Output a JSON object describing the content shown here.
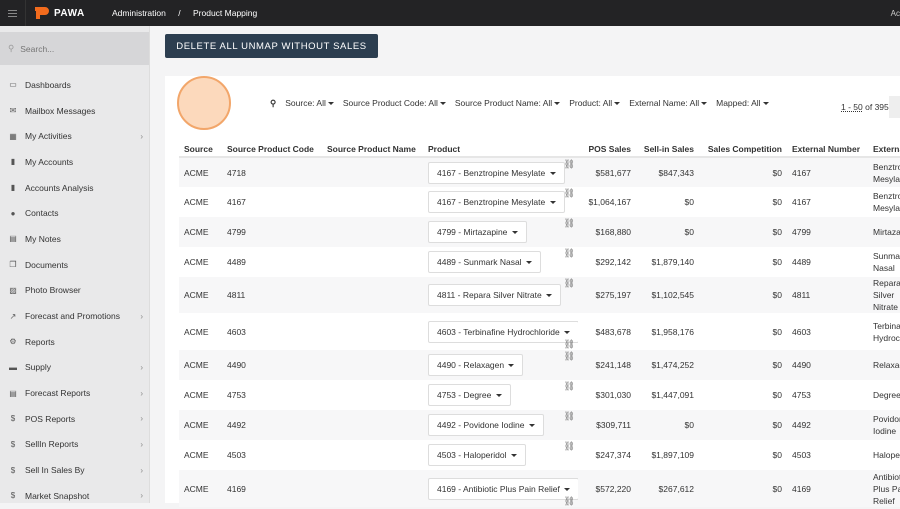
{
  "topbar": {
    "brand": "PAWA",
    "breadcrumb": [
      "Administration",
      "/",
      "Product Mapping"
    ],
    "user": "Ac"
  },
  "sidebar": {
    "search_placeholder": "Search...",
    "items": [
      {
        "label": "Dashboards",
        "icon": "monitor-icon",
        "chevron": false
      },
      {
        "label": "Mailbox Messages",
        "icon": "envelope-icon",
        "chevron": false
      },
      {
        "label": "My Activities",
        "icon": "calendar-icon",
        "chevron": true
      },
      {
        "label": "My Accounts",
        "icon": "building-icon",
        "chevron": false
      },
      {
        "label": "Accounts Analysis",
        "icon": "building-icon",
        "chevron": false
      },
      {
        "label": "Contacts",
        "icon": "user-icon",
        "chevron": false
      },
      {
        "label": "My Notes",
        "icon": "note-icon",
        "chevron": false
      },
      {
        "label": "Documents",
        "icon": "documents-icon",
        "chevron": false
      },
      {
        "label": "Photo Browser",
        "icon": "image-icon",
        "chevron": false
      },
      {
        "label": "Forecast and Promotions",
        "icon": "chart-line-icon",
        "chevron": true
      },
      {
        "label": "Reports",
        "icon": "gear-icon",
        "chevron": false
      },
      {
        "label": "Supply",
        "icon": "truck-icon",
        "chevron": true
      },
      {
        "label": "Forecast Reports",
        "icon": "table-icon",
        "chevron": true
      },
      {
        "label": "POS Reports",
        "icon": "dollar-icon",
        "chevron": true
      },
      {
        "label": "SellIn Reports",
        "icon": "dollar-icon",
        "chevron": true
      },
      {
        "label": "Sell In Sales By",
        "icon": "dollar-icon",
        "chevron": true
      },
      {
        "label": "Market Snapshot",
        "icon": "dollar-icon",
        "chevron": true
      }
    ]
  },
  "main": {
    "delete_button": "DELETE ALL UNMAP WITHOUT SALES",
    "filters": [
      "Source: All",
      "Source Product Code: All",
      "Source Product Name: All",
      "Product: All",
      "External Name: All",
      "Mapped: All"
    ],
    "pager": {
      "range": "1 - 50",
      "of": "of 395"
    },
    "columns": [
      "Source",
      "Source Product Code",
      "Source Product Name",
      "Product",
      "POS Sales",
      "Sell-in Sales",
      "Sales Competition",
      "External Number",
      "External Name"
    ],
    "rows": [
      {
        "source": "ACME",
        "code": "4718",
        "name": "",
        "product": "4167 - Benztropine Mesylate",
        "pos": "$581,677",
        "sellin": "$847,343",
        "comp": "$0",
        "extnum": "4167",
        "extname": "Benztropine Mesylate"
      },
      {
        "source": "ACME",
        "code": "4167",
        "name": "",
        "product": "4167 - Benztropine Mesylate",
        "pos": "$1,064,167",
        "sellin": "$0",
        "comp": "$0",
        "extnum": "4167",
        "extname": "Benztropine Mesylate"
      },
      {
        "source": "ACME",
        "code": "4799",
        "name": "",
        "product": "4799 - Mirtazapine",
        "pos": "$168,880",
        "sellin": "$0",
        "comp": "$0",
        "extnum": "4799",
        "extname": "Mirtazapine"
      },
      {
        "source": "ACME",
        "code": "4489",
        "name": "",
        "product": "4489 - Sunmark Nasal",
        "pos": "$292,142",
        "sellin": "$1,879,140",
        "comp": "$0",
        "extnum": "4489",
        "extname": "Sunmark Nasal"
      },
      {
        "source": "ACME",
        "code": "4811",
        "name": "",
        "product": "4811 - Repara Silver Nitrate",
        "pos": "$275,197",
        "sellin": "$1,102,545",
        "comp": "$0",
        "extnum": "4811",
        "extname": "Repara Silver Nitrate"
      },
      {
        "source": "ACME",
        "code": "4603",
        "name": "",
        "product": "4603 - Terbinafine Hydrochloride",
        "pos": "$483,678",
        "sellin": "$1,958,176",
        "comp": "$0",
        "extnum": "4603",
        "extname": "Terbinafine Hydrochloride",
        "tall": true
      },
      {
        "source": "ACME",
        "code": "4490",
        "name": "",
        "product": "4490 - Relaxagen",
        "pos": "$241,148",
        "sellin": "$1,474,252",
        "comp": "$0",
        "extnum": "4490",
        "extname": "Relaxagen"
      },
      {
        "source": "ACME",
        "code": "4753",
        "name": "",
        "product": "4753 - Degree",
        "pos": "$301,030",
        "sellin": "$1,447,091",
        "comp": "$0",
        "extnum": "4753",
        "extname": "Degree"
      },
      {
        "source": "ACME",
        "code": "4492",
        "name": "",
        "product": "4492 - Povidone Iodine",
        "pos": "$309,711",
        "sellin": "$0",
        "comp": "$0",
        "extnum": "4492",
        "extname": "Povidone Iodine"
      },
      {
        "source": "ACME",
        "code": "4503",
        "name": "",
        "product": "4503 - Haloperidol",
        "pos": "$247,374",
        "sellin": "$1,897,109",
        "comp": "$0",
        "extnum": "4503",
        "extname": "Haloperidol"
      },
      {
        "source": "ACME",
        "code": "4169",
        "name": "",
        "product": "4169 - Antibiotic Plus Pain Relief",
        "pos": "$572,220",
        "sellin": "$267,612",
        "comp": "$0",
        "extnum": "4169",
        "extname": "Antibiotic Plus Pain Relief",
        "tall": true
      }
    ]
  },
  "colors": {
    "topbar": "#232325",
    "button": "#2c3e50",
    "brand": "#f26b1d"
  }
}
